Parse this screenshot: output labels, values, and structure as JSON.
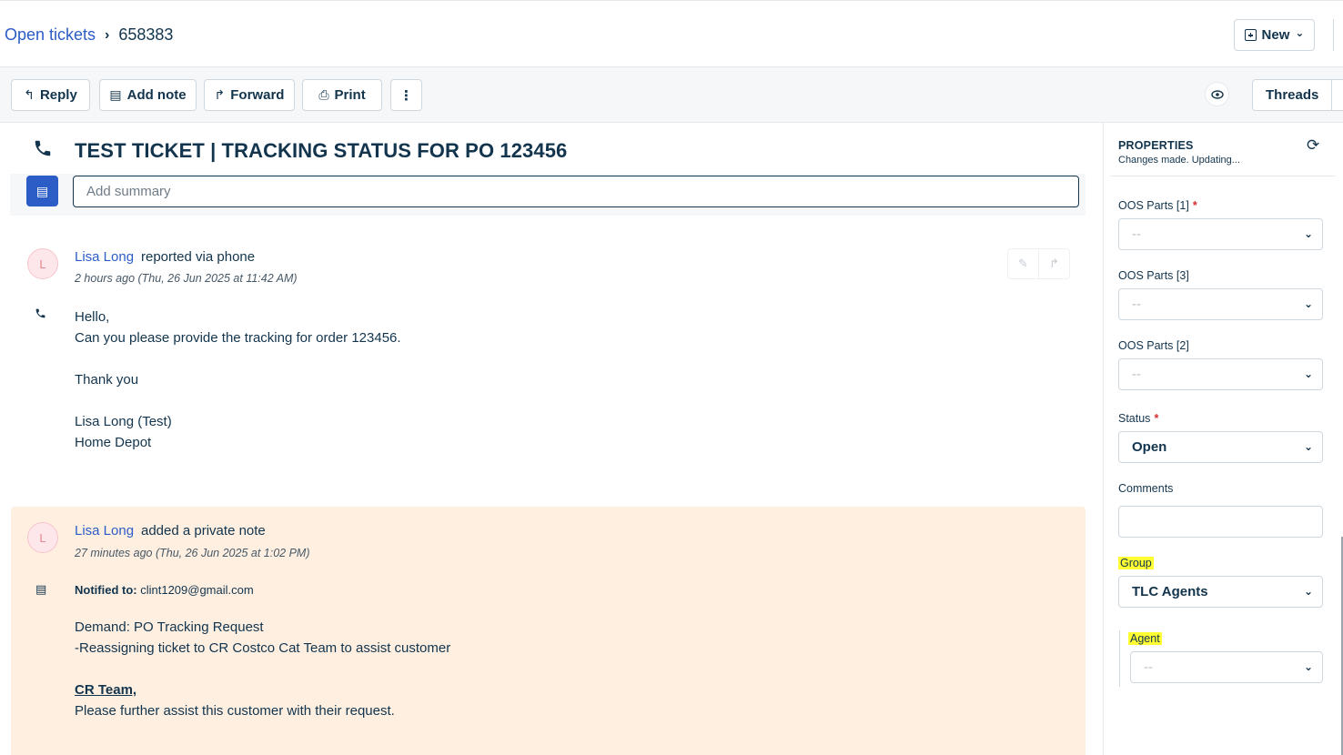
{
  "header": {
    "breadcrumb_link": "Open tickets",
    "breadcrumb_sep": "›",
    "ticket_id": "658383",
    "new_label": "New",
    "new_chevron": "⌄"
  },
  "toolbar": {
    "reply_label": "Reply",
    "add_note_label": "Add note",
    "forward_label": "Forward",
    "print_label": "Print",
    "more_label": "⋮",
    "threads_label": "Threads"
  },
  "ticket": {
    "subject": "TEST TICKET | TRACKING STATUS FOR PO 123456",
    "summary_placeholder": "Add summary"
  },
  "conversation": [
    {
      "avatar": "L",
      "author": "Lisa Long",
      "action": "reported via phone",
      "timestamp": "2 hours ago (Thu, 26 Jun 2025 at 11:42 AM)",
      "lines": [
        "Hello,",
        "Can you please provide the tracking for order 123456.",
        "Thank you",
        "Lisa Long (Test)",
        "Home Depot"
      ]
    },
    {
      "avatar": "L",
      "author": "Lisa Long",
      "action": "added a private note",
      "timestamp": "27 minutes ago (Thu, 26 Jun 2025 at 1:02 PM)",
      "notified_label": "Notified to:",
      "notified_value": "clint1209@gmail.com",
      "lines": [
        "Demand: PO Tracking Request",
        "-Reassigning ticket to CR Costco Cat Team to assist customer",
        "CR Team,",
        "Please further assist this customer with their request."
      ]
    }
  ],
  "properties": {
    "title": "PROPERTIES",
    "status_msg": "Changes made. Updating...",
    "fields": [
      {
        "label": "OOS Parts [1]",
        "required": true,
        "value": "--"
      },
      {
        "label": "OOS Parts [3]",
        "required": false,
        "value": "--"
      },
      {
        "label": "OOS Parts [2]",
        "required": false,
        "value": "--"
      },
      {
        "label": "Status",
        "required": true,
        "value": "Open"
      },
      {
        "label": "Comments",
        "required": false,
        "value": ""
      },
      {
        "label": "Group",
        "required": false,
        "value": "TLC Agents"
      },
      {
        "label": "Agent",
        "required": false,
        "value": "--"
      }
    ],
    "required_mark": "*"
  },
  "colors": {
    "accent": "#2c5cc5",
    "note_bg": "#feefe1",
    "highlight": "#ffff33"
  }
}
